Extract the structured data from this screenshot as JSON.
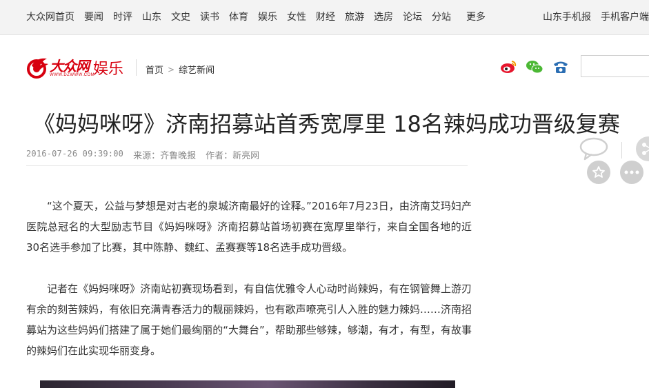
{
  "top_nav": {
    "items": [
      "大众网首页",
      "要闻",
      "时评",
      "山东",
      "文史",
      "读书",
      "体育",
      "娱乐",
      "女性",
      "财经",
      "旅游",
      "选房",
      "论坛",
      "分站"
    ],
    "more": "更多",
    "right_links": [
      "山东手机报",
      "手机客户端"
    ]
  },
  "header": {
    "logo_brand": "大众网",
    "logo_url_text": "WWW.DZWWW.COM",
    "section": "娱乐",
    "breadcrumb": {
      "home": "首页",
      "separator": ">",
      "current": "综艺新闻"
    },
    "social_icons": [
      "weibo-icon",
      "wechat-icon",
      "phone-icon"
    ]
  },
  "article": {
    "title": "《妈妈咪呀》济南招募站首秀宽厚里 18名辣妈成功晋级复赛",
    "date": "2016-07-26 09:39:00",
    "source": "来源：齐鲁晚报",
    "author": "作者：新亮网",
    "paragraphs": [
      "“这个夏天，公益与梦想是对古老的泉城济南最好的诠释。”2016年7月23日，由济南艾玛妇产医院总冠名的大型励志节目《妈妈咪呀》济南招募站首场初赛在宽厚里举行，来自全国各地的近30名选手参加了比赛，其中陈静、魏红、孟赛赛等18名选手成功晋级。",
      "记者在《妈妈咪呀》济南站初赛现场看到，有自信优雅令人心动时尚辣妈，有在钢管舞上游刃有余的刻苦辣妈，有依旧充满青春活力的靓丽辣妈，也有歌声嘹亮引人入胜的魅力辣妈……济南招募站为这些妈妈们搭建了属于她们最绚丽的“大舞台”，帮助那些够辣，够潮，有才，有型，有故事的辣妈们在此实现华丽变身。"
    ]
  },
  "tools": [
    "comment-icon",
    "share-icon",
    "favorite-icon",
    "more-icon"
  ],
  "colors": {
    "brand_red": "#d7000f",
    "top_bar_bg": "#f3f3f3",
    "weibo_red": "#e6162d",
    "wechat_green": "#4bb834",
    "phone_blue": "#2b6eb3"
  }
}
